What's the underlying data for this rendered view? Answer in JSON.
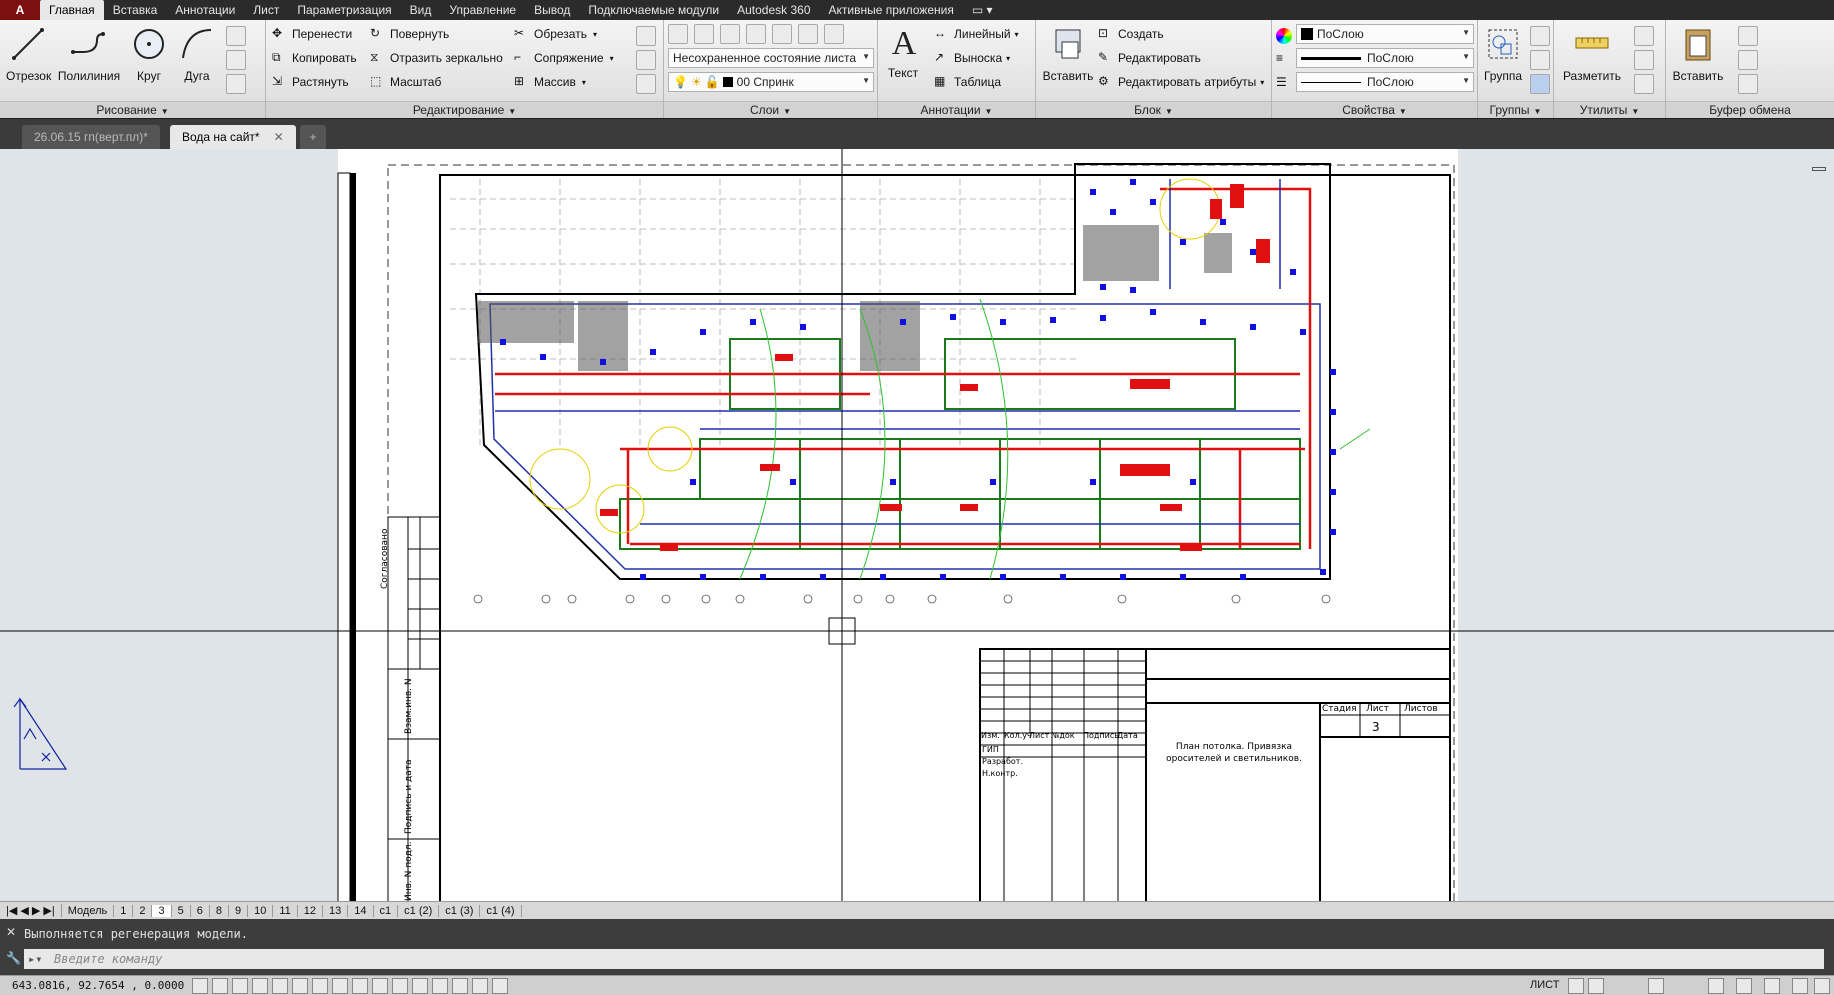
{
  "menu": {
    "app_button": "A",
    "tabs": [
      "Главная",
      "Вставка",
      "Аннотации",
      "Лист",
      "Параметризация",
      "Вид",
      "Управление",
      "Вывод",
      "Подключаемые модули",
      "Autodesk 360",
      "Активные приложения"
    ]
  },
  "ribbon": {
    "draw": {
      "title": "Рисование",
      "line": "Отрезок",
      "polyline": "Полилиния",
      "circle": "Круг",
      "arc": "Дуга"
    },
    "modify": {
      "title": "Редактирование",
      "move": "Перенести",
      "copy": "Копировать",
      "stretch": "Растянуть",
      "rotate": "Повернуть",
      "mirror": "Отразить зеркально",
      "scale": "Масштаб",
      "trim": "Обрезать",
      "fillet": "Сопряжение",
      "array": "Массив"
    },
    "layers": {
      "title": "Слои",
      "state": "Несохраненное состояние листа",
      "current_layer": "00 Спринк"
    },
    "annotation": {
      "title": "Аннотации",
      "text": "Текст",
      "linear": "Линейный",
      "leader": "Выноска",
      "table": "Таблица"
    },
    "block": {
      "title": "Блок",
      "insert": "Вставить",
      "create": "Создать",
      "edit": "Редактировать",
      "edit_attributes": "Редактировать атрибуты"
    },
    "properties": {
      "title": "Свойства",
      "color": "ПоСлою",
      "linetype": "ПоСлою",
      "lineweight": "ПоСлою"
    },
    "groups": {
      "title": "Группы",
      "group": "Группа"
    },
    "utilities": {
      "title": "Утилиты",
      "measure": "Разметить"
    },
    "clipboard": {
      "title": "Буфер обмена",
      "paste": "Вставить"
    }
  },
  "file_tabs": [
    {
      "label": "26.06.15 гп(верт.пл)*"
    },
    {
      "label": "Вода на сайт*"
    }
  ],
  "title_block": {
    "headers": [
      "Изм.",
      "Кол.уч",
      "Лист",
      "№док",
      "Подпись",
      "Дата"
    ],
    "roles": [
      "ГИП",
      "Разработ.",
      "Н.контр."
    ],
    "stage_header": "Стадия",
    "sheet_header": "Лист",
    "sheets_header": "Листов",
    "sheet_number": "3",
    "title_line1": "План потолка. Привязка",
    "title_line2": "оросителей и светильников.",
    "side_labels": [
      "Согласовано",
      "Взам.инв. N",
      "Подпись и дата",
      "Инв. N подл."
    ]
  },
  "layout_tabs": [
    "Модель",
    "1",
    "2",
    "3",
    "5",
    "6",
    "8",
    "9",
    "10",
    "11",
    "12",
    "13",
    "14",
    "с1",
    "с1 (2)",
    "с1 (3)",
    "с1 (4)"
  ],
  "active_layout": "3",
  "command": {
    "history": "Выполняется регенерация модели.",
    "placeholder": "Введите команду"
  },
  "status": {
    "coords": "643.0816, 92.7654 , 0.0000",
    "space": "ЛИСТ"
  }
}
